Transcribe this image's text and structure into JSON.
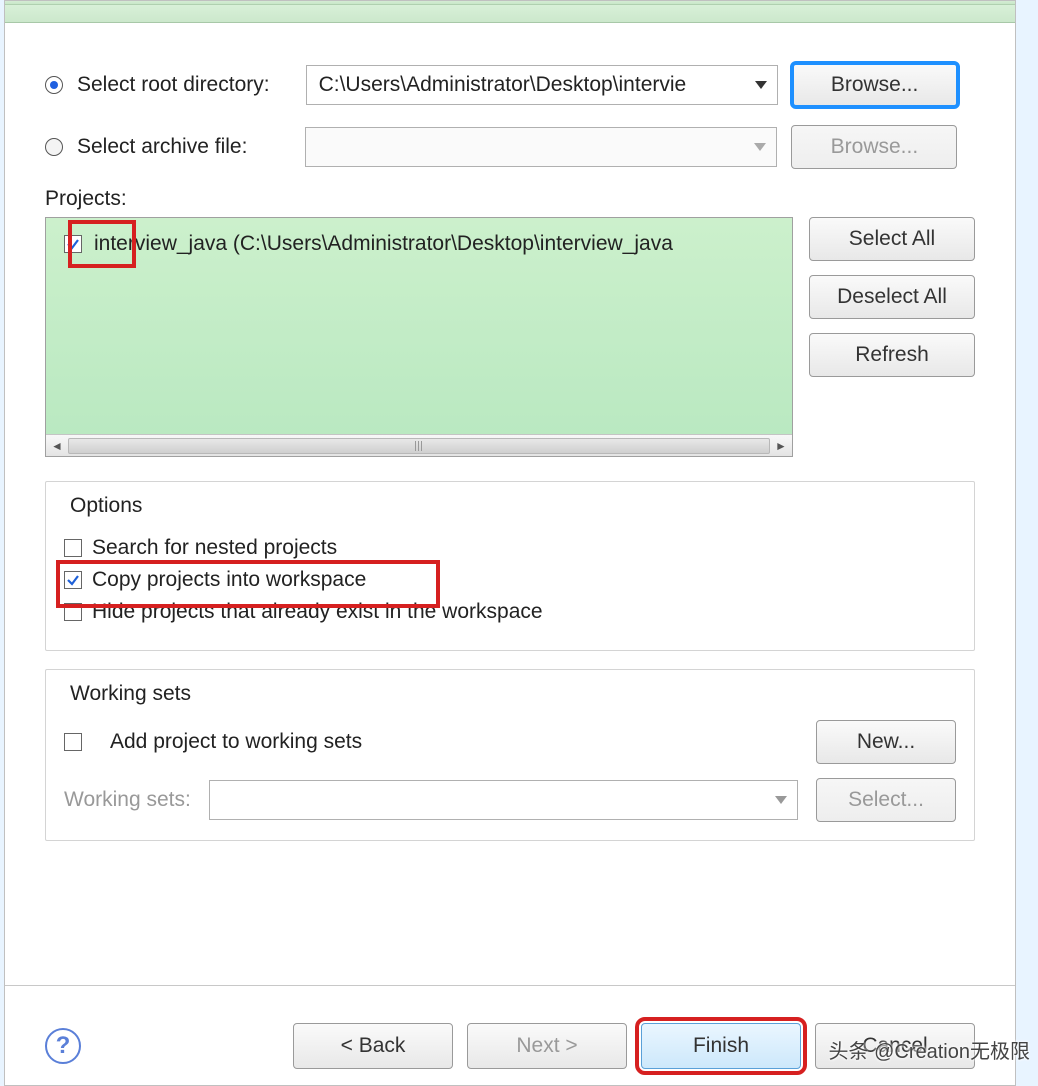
{
  "source": {
    "root_label": "Select root directory:",
    "root_path": "C:\\Users\\Administrator\\Desktop\\intervie",
    "archive_label": "Select archive file:",
    "archive_path": "",
    "browse_label": "Browse...",
    "browse_label2": "Browse..."
  },
  "projects": {
    "header": "Projects:",
    "items": [
      {
        "checked": true,
        "label": "interview_java (C:\\Users\\Administrator\\Desktop\\interview_java"
      }
    ],
    "select_all": "Select All",
    "deselect_all": "Deselect All",
    "refresh": "Refresh"
  },
  "options": {
    "title": "Options",
    "search_nested": "Search for nested projects",
    "copy_into_ws": "Copy projects into workspace",
    "hide_existing": "Hide projects that already exist in the workspace"
  },
  "working_sets": {
    "title": "Working sets",
    "add_label": "Add project to working sets",
    "new_btn": "New...",
    "ws_label": "Working sets:",
    "select_btn": "Select..."
  },
  "footer": {
    "back": "< Back",
    "next": "Next >",
    "finish": "Finish",
    "cancel": "Cancel"
  },
  "watermark": "头条 @Creation无极限"
}
